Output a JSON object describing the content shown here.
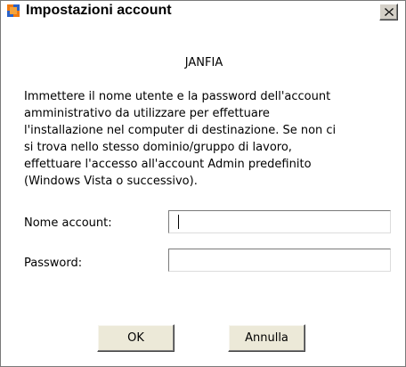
{
  "window": {
    "title": "Impostazioni account",
    "close_glyph": "✕",
    "icon": "app-icon"
  },
  "machine_name": "JANFIA",
  "description_lines": [
    "Immettere il nome utente e la password dell'account",
    "amministrativo da utilizzare per effettuare",
    "l'installazione nel computer di destinazione. Se non ci",
    "si trova nello stesso dominio/gruppo di lavoro,",
    "effettuare l'accesso all'account Admin predefinito",
    "(Windows Vista o successivo)."
  ],
  "form": {
    "account_label": "Nome account:",
    "account_value": "",
    "password_label": "Password:",
    "password_value": ""
  },
  "buttons": {
    "ok_label": "OK",
    "cancel_label": "Annulla"
  },
  "colors": {
    "button_face": "#ece9d8",
    "icon_orange": "#f07a10",
    "icon_blue": "#2a62c8"
  }
}
